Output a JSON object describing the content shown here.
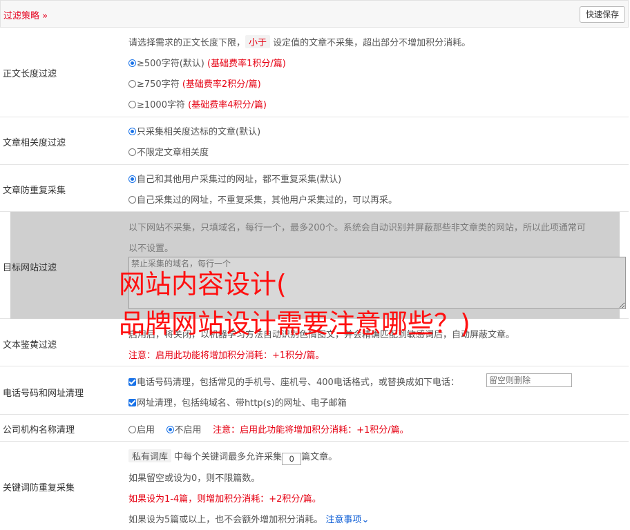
{
  "header": {
    "title": "过滤策略",
    "save_label": "快速保存"
  },
  "length_filter": {
    "label": "正文长度过滤",
    "desc_pre": "请选择需求的正文长度下限，",
    "desc_tag": "小于",
    "desc_post": "设定值的文章不采集，超出部分不增加积分消耗。",
    "options": [
      {
        "text": "≥500字符(默认)",
        "note": "(基础费率1积分/篇)",
        "selected": true
      },
      {
        "text": "≥750字符",
        "note": "(基础费率2积分/篇)",
        "selected": false
      },
      {
        "text": "≥1000字符",
        "note": "(基础费率4积分/篇)",
        "selected": false
      }
    ]
  },
  "relevance": {
    "label": "文章相关度过滤",
    "options": [
      {
        "text": "只采集相关度达标的文章(默认)",
        "selected": true
      },
      {
        "text": "不限定文章相关度",
        "selected": false
      }
    ]
  },
  "dedupe": {
    "label": "文章防重复采集",
    "options": [
      {
        "text": "自己和其他用户采集过的网址，都不重复采集(默认)",
        "selected": true
      },
      {
        "text": "自己采集过的网址，不重复采集，其他用户采集过的，可以再采。",
        "selected": false
      }
    ]
  },
  "target_site": {
    "label": "目标网站过滤",
    "desc1": "以下网站不采集，只填域名，每行一个，最多200个。系统会自动识别并屏蔽那些非文章类的网站，所以此项通常可",
    "desc2": "以不设置。",
    "placeholder": "禁止采集的域名，每行一个"
  },
  "porn": {
    "label": "文本鉴黄过滤",
    "desc": "启用后，将关闭，以机器学习方法自动识别色情图文，并会精确匹配到敏感词后，自动屏蔽文章。",
    "note": "注意：启用此功能将增加积分消耗：+1积分/篇。"
  },
  "phone": {
    "label": "电话号码和网址清理",
    "opt1": "电话号码清理，包括常见的手机号、座机号、400电话格式，或替换成如下电话：",
    "opt1_placeholder": "留空则删除",
    "opt2": "网址清理，包括纯域名、带http(s)的网址、电子邮箱"
  },
  "company": {
    "label": "公司机构名称清理",
    "on": "启用",
    "off": "不启用",
    "note": "注意：启用此功能将增加积分消耗：+1积分/篇。"
  },
  "keyword": {
    "label": "关键词防重复采集",
    "tag": "私有词库",
    "line1_pre": "中每个关键词最多允许采集",
    "line1_value": "0",
    "line1_post": "篇文章。",
    "line2": "如果留空或设为0，则不限篇数。",
    "line3": "如果设为1-4篇，则增加积分消耗：+2积分/篇。",
    "line4": "如果设为5篇或以上，也不会额外增加积分消耗。",
    "notes_link": "注意事项"
  },
  "overlay": {
    "line1": "网站内容设计(",
    "line2": "品牌网站设计需要注意哪些？)"
  }
}
